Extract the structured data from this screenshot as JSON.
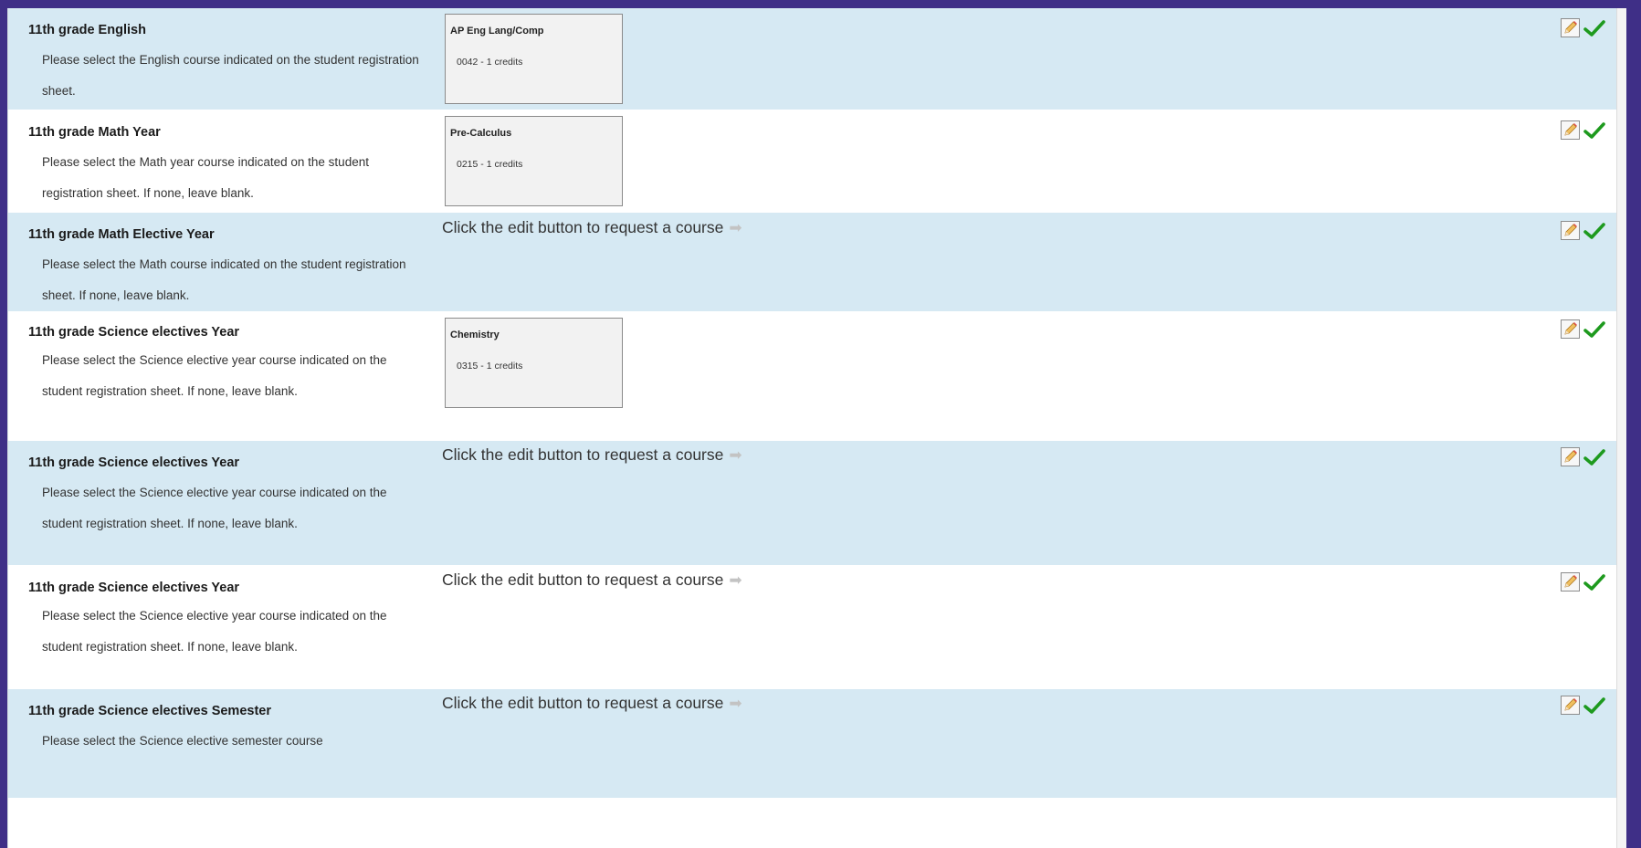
{
  "requests": [
    {
      "title": "11th grade English",
      "description": "Please select the English course indicated on the student registration sheet.",
      "course": {
        "name": "AP Eng Lang/Comp",
        "credits": "0042 - 1 credits"
      }
    },
    {
      "title": "11th grade Math Year",
      "description": "Please select the Math year course indicated on the student registration sheet. If none, leave blank.",
      "course": {
        "name": "Pre-Calculus",
        "credits": "0215 - 1 credits"
      }
    },
    {
      "title": "11th grade Math Elective Year",
      "description": "Please select the Math course indicated on the student registration sheet. If none, leave blank.",
      "prompt": "Click the edit button to request a course"
    },
    {
      "title": "11th grade Science electives Year",
      "description": "Please select the Science elective year course indicated on the student registration sheet. If none, leave blank.",
      "course": {
        "name": "Chemistry",
        "credits": "0315 - 1 credits"
      }
    },
    {
      "title": "11th grade Science electives Year",
      "description": "Please select the Science elective year course indicated on the student registration sheet. If none, leave blank.",
      "prompt": "Click the edit button to request a course"
    },
    {
      "title": "11th grade Science electives Year",
      "description": "Please select the Science elective year course indicated on the student registration sheet. If none, leave blank.",
      "prompt": "Click the edit button to request a course"
    },
    {
      "title": "11th grade Science electives Semester",
      "description": "Please select the Science elective semester course",
      "prompt": "Click the edit button to request a course"
    }
  ],
  "icons": {
    "edit": "pencil-edit-icon",
    "check": "green-checkmark-icon",
    "arrow": "right-arrow-icon"
  },
  "colors": {
    "outer_border": "#3f2f87",
    "row_shaded": "#d6e9f3",
    "row_plain": "#ffffff",
    "check": "#1e9a1e",
    "pencil": "#f0c060"
  }
}
